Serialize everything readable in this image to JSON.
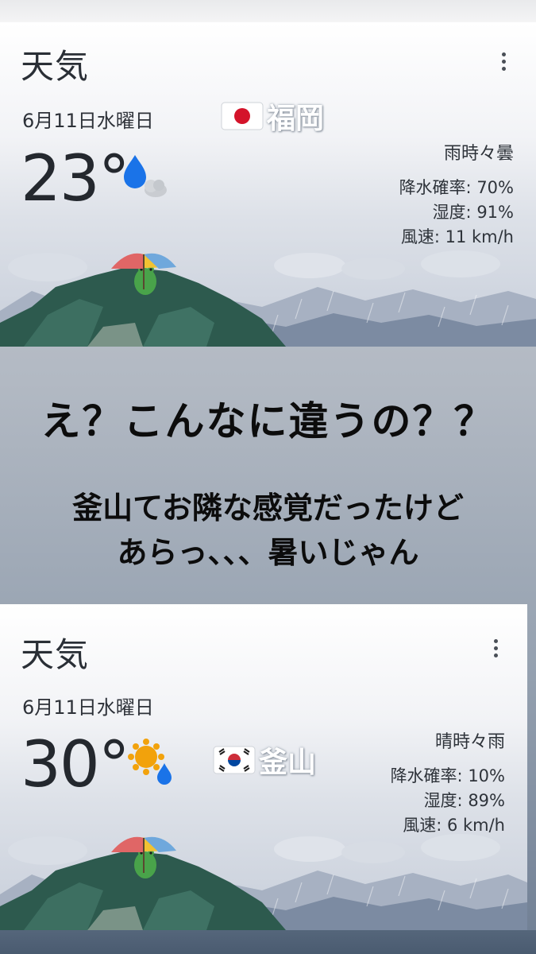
{
  "cards": [
    {
      "title": "天気",
      "date": "6月11日水曜日",
      "temperature": "23°",
      "weather_icon": "rain-cloud-icon",
      "city": "福岡",
      "flag": "japan-flag",
      "condition": "雨時々曇",
      "precipitation": "降水確率: 70%",
      "humidity": "湿度: 91%",
      "wind": "風速: 11 km/h",
      "menu_icon": "more-vert-icon"
    },
    {
      "title": "天気",
      "date": "6月11日水曜日",
      "temperature": "30°",
      "weather_icon": "sun-rain-icon",
      "city": "釜山",
      "flag": "south-korea-flag",
      "condition": "晴時々雨",
      "precipitation": "降水確率: 10%",
      "humidity": "湿度: 89%",
      "wind": "風速: 6 km/h",
      "menu_icon": "more-vert-icon"
    }
  ],
  "caption": {
    "headline": "え？こんなに違うの？？",
    "line1": "釜山てお隣な感覚だったけど",
    "line2": "あらっ、、、暑いじゃん"
  },
  "colors": {
    "rain_drop": "#1a73e8",
    "sun": "#f2a20c",
    "frog": "#49a34a",
    "hill": "#2d5a4e"
  }
}
